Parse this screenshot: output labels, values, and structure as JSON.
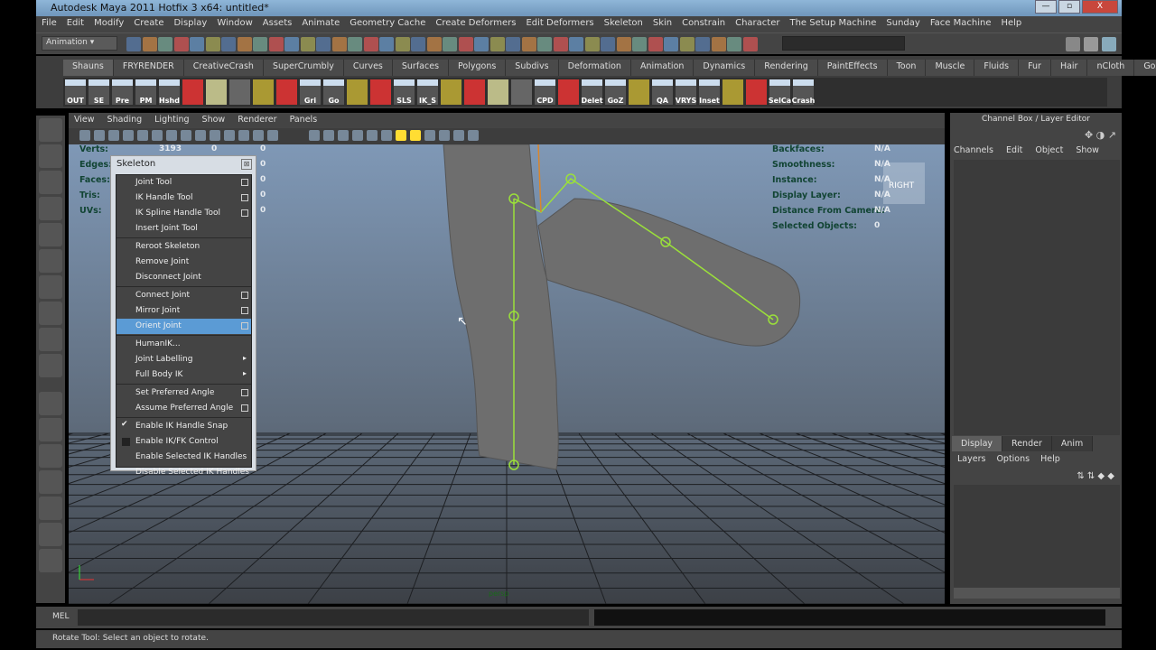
{
  "window": {
    "title": "Autodesk Maya 2011 Hotfix 3 x64: untitled*",
    "minimize": "—",
    "maximize": "▫",
    "close": "X"
  },
  "menubar": [
    "File",
    "Edit",
    "Modify",
    "Create",
    "Display",
    "Window",
    "Assets",
    "Animate",
    "Geometry Cache",
    "Create Deformers",
    "Edit Deformers",
    "Skeleton",
    "Skin",
    "Constrain",
    "Character",
    "The Setup Machine",
    "Sunday",
    "Face Machine",
    "Help"
  ],
  "toolbar": {
    "mode": "Animation"
  },
  "shelf": {
    "tabs": [
      "Shauns",
      "FRYRENDER",
      "CreativeCrash",
      "SuperCrumbly",
      "Curves",
      "Surfaces",
      "Polygons",
      "Subdivs",
      "Deformation",
      "Animation",
      "Dynamics",
      "Rendering",
      "PaintEffects",
      "Toon",
      "Muscle",
      "Fluids",
      "Fur",
      "Hair",
      "nCloth",
      "GoZBrush"
    ],
    "active": "Shauns",
    "icons": [
      "OUT",
      "SE",
      "Pre",
      "PM",
      "Hshd",
      "",
      "",
      "",
      "",
      "",
      "Gri",
      "Go",
      "",
      "",
      "SLS",
      "IK_S",
      "",
      "",
      "",
      "",
      "CPD",
      "",
      "Delet",
      "GoZ",
      "",
      "QA",
      "VRYS",
      "Inset",
      "",
      "",
      "SelCa",
      "Crash"
    ]
  },
  "viewport": {
    "menu": [
      "View",
      "Shading",
      "Lighting",
      "Show",
      "Renderer",
      "Panels"
    ],
    "hud_left": [
      {
        "label": "Verts:",
        "v": [
          "3193",
          "0",
          "0"
        ]
      },
      {
        "label": "Edges:",
        "v": [
          "",
          "",
          "0"
        ]
      },
      {
        "label": "Faces:",
        "v": [
          "",
          "",
          "0"
        ]
      },
      {
        "label": "Tris:",
        "v": [
          "",
          "",
          "0"
        ]
      },
      {
        "label": "UVs:",
        "v": [
          "",
          "",
          "0"
        ]
      }
    ],
    "hud_right": [
      {
        "label": "Backfaces:",
        "v": "N/A"
      },
      {
        "label": "Smoothness:",
        "v": "N/A"
      },
      {
        "label": "Instance:",
        "v": "N/A"
      },
      {
        "label": "Display Layer:",
        "v": "N/A"
      },
      {
        "label": "Distance From Camera:",
        "v": "N/A"
      },
      {
        "label": "Selected Objects:",
        "v": "0"
      }
    ],
    "viewcube": "RIGHT",
    "camera": "persp"
  },
  "skeleton_menu": {
    "title": "Skeleton",
    "items": [
      {
        "label": "Joint Tool",
        "opt": true
      },
      {
        "label": "IK Handle Tool",
        "opt": true
      },
      {
        "label": "IK Spline Handle Tool",
        "opt": true
      },
      {
        "label": "Insert Joint Tool"
      },
      {
        "sep": true
      },
      {
        "label": "Reroot Skeleton"
      },
      {
        "label": "Remove Joint"
      },
      {
        "label": "Disconnect Joint"
      },
      {
        "sep": true
      },
      {
        "label": "Connect Joint",
        "opt": true
      },
      {
        "label": "Mirror Joint",
        "opt": true
      },
      {
        "label": "Orient Joint",
        "opt": true,
        "highlighted": true
      },
      {
        "sep": true
      },
      {
        "label": "HumanIK..."
      },
      {
        "label": "Joint Labelling",
        "sub": true
      },
      {
        "label": "Full Body IK",
        "sub": true
      },
      {
        "sep": true
      },
      {
        "label": "Set Preferred Angle",
        "opt": true
      },
      {
        "label": "Assume Preferred Angle",
        "opt": true
      },
      {
        "sep": true
      },
      {
        "label": "Enable IK Handle Snap",
        "checked": true
      },
      {
        "label": "Enable IK/FK Control",
        "checked": false
      },
      {
        "label": "Enable Selected IK Handles"
      },
      {
        "label": "Disable Selected IK Handles"
      }
    ]
  },
  "channel_box": {
    "title": "Channel Box / Layer Editor",
    "menu": [
      "Channels",
      "Edit",
      "Object",
      "Show"
    ]
  },
  "layer_editor": {
    "tabs": [
      "Display",
      "Render",
      "Anim"
    ],
    "active": "Display",
    "menu": [
      "Layers",
      "Options",
      "Help"
    ]
  },
  "command_line": {
    "label": "MEL"
  },
  "status": {
    "help": "Rotate Tool: Select an object to rotate."
  },
  "colors": {
    "joint": "#9be03a",
    "highlight": "#5b9bd5",
    "viewport_top": "#7f98b6",
    "viewport_bottom": "#3c4046"
  }
}
